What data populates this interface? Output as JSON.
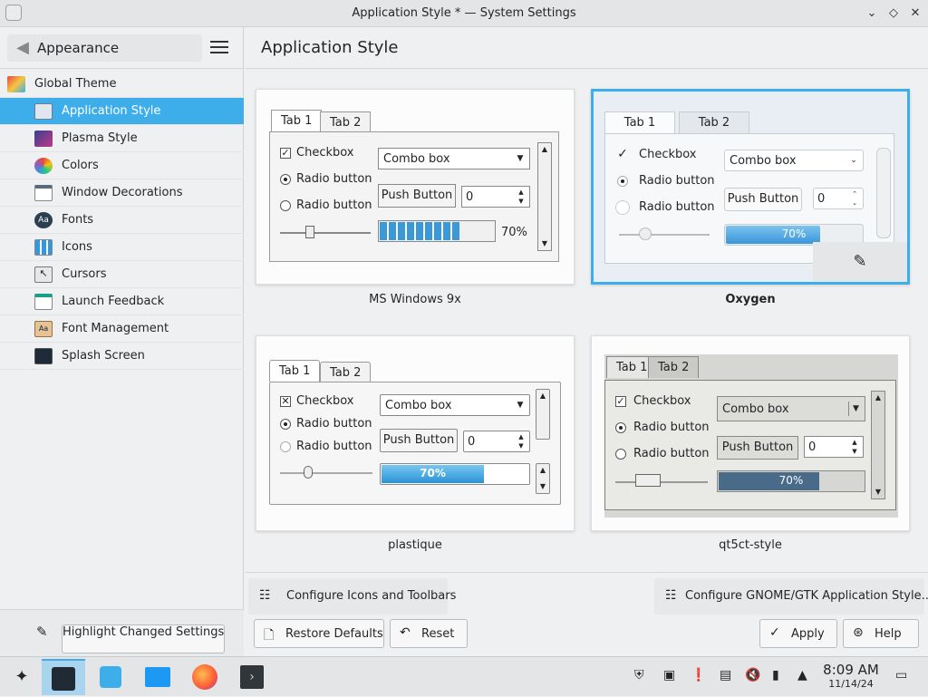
{
  "window": {
    "title": "Application Style * — System Settings",
    "controls": [
      "⌄",
      "◇",
      "✕"
    ]
  },
  "sidebar": {
    "back_label": "Appearance",
    "items": [
      {
        "label": "Global Theme",
        "icon": "global-theme-icon",
        "color": "#e24a3c"
      },
      {
        "label": "Application Style",
        "icon": "application-style-icon",
        "color": "#4a90d9"
      },
      {
        "label": "Plasma Style",
        "icon": "plasma-style-icon",
        "color": "#8e44ad"
      },
      {
        "label": "Colors",
        "icon": "colors-icon",
        "color": "#f39c12"
      },
      {
        "label": "Window Decorations",
        "icon": "window-decorations-icon",
        "color": "#7f8c8d"
      },
      {
        "label": "Fonts",
        "icon": "fonts-icon",
        "color": "#2c3e50"
      },
      {
        "label": "Icons",
        "icon": "icons-icon",
        "color": "#3498db"
      },
      {
        "label": "Cursors",
        "icon": "cursors-icon",
        "color": "#95a5a6"
      },
      {
        "label": "Launch Feedback",
        "icon": "launch-feedback-icon",
        "color": "#16a085"
      },
      {
        "label": "Font Management",
        "icon": "font-management-icon",
        "color": "#d35400"
      },
      {
        "label": "Splash Screen",
        "icon": "splash-screen-icon",
        "color": "#2980b9"
      }
    ],
    "footer_label": "Highlight Changed Settings"
  },
  "main": {
    "title": "Application Style",
    "styles": [
      {
        "name": "MS Windows 9x",
        "selected": false,
        "tab1": "Tab 1",
        "tab2": "Tab 2",
        "checkbox": "Checkbox",
        "radio1": "Radio button",
        "radio2": "Radio button",
        "combo": "Combo box",
        "push": "Push Button",
        "spin": "0",
        "progress_label": "70%",
        "progress": 0.7
      },
      {
        "name": "Oxygen",
        "selected": true,
        "tab1": "Tab 1",
        "tab2": "Tab 2",
        "checkbox": "Checkbox",
        "radio1": "Radio button",
        "radio2": "Radio button",
        "combo": "Combo box",
        "push": "Push Button",
        "spin": "0",
        "progress_label": "70%",
        "progress": 0.7
      },
      {
        "name": "plastique",
        "selected": false,
        "tab1": "Tab 1",
        "tab2": "Tab 2",
        "checkbox": "Checkbox",
        "radio1": "Radio button",
        "radio2": "Radio button",
        "combo": "Combo box",
        "push": "Push Button",
        "spin": "0",
        "progress_label": "70%",
        "progress": 0.7
      },
      {
        "name": "qt5ct-style",
        "selected": false,
        "tab1": "Tab 1",
        "tab2": "Tab 2",
        "checkbox": "Checkbox",
        "radio1": "Radio button",
        "radio2": "Radio button",
        "combo": "Combo box",
        "push": "Push Button",
        "spin": "0",
        "progress_label": "70%",
        "progress": 0.7
      }
    ],
    "configure_icons_label": "Configure Icons and Toolbars",
    "configure_gtk_label": "Configure GNOME/GTK Application Style...",
    "restore_label": "Restore Defaults",
    "reset_label": "Reset",
    "apply_label": "Apply",
    "help_label": "Help"
  },
  "taskbar": {
    "apps": [
      "application-launcher-icon",
      "system-settings-icon",
      "discover-icon",
      "dolphin-icon",
      "firefox-icon",
      "konsole-icon"
    ],
    "time": "8:09 AM",
    "date": "11/14/24"
  },
  "colors": {
    "accent": "#3daee9",
    "sidebar_active": "#3daee9",
    "oxygen_progress": "#4aa3df",
    "plastique_progress": "#3aa6e6",
    "qt5ct_progress": "#4a6a8a"
  }
}
